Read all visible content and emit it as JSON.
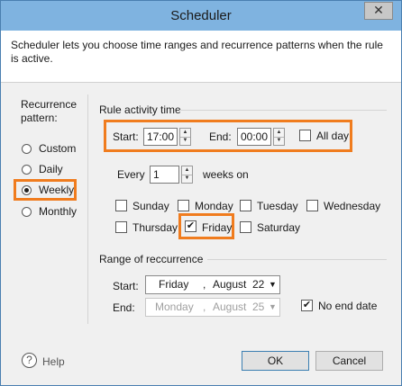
{
  "window": {
    "title": "Scheduler",
    "close_glyph": "✕"
  },
  "intro": {
    "text": "Scheduler lets you choose time ranges and recurrence patterns when the rule is active."
  },
  "recurrence": {
    "label": "Recurrence pattern:",
    "options": [
      {
        "label": "Custom",
        "selected": false
      },
      {
        "label": "Daily",
        "selected": false
      },
      {
        "label": "Weekly",
        "selected": true
      },
      {
        "label": "Monthly",
        "selected": false
      }
    ]
  },
  "activity": {
    "heading": "Rule activity time",
    "start_label": "Start:",
    "start_value": "17:00",
    "end_label": "End:",
    "end_value": "00:00",
    "all_day_label": "All day",
    "all_day_checked": false
  },
  "weekly": {
    "every_label": "Every",
    "every_value": "1",
    "weeks_on_label": "weeks on",
    "days": [
      {
        "label": "Sunday",
        "checked": false
      },
      {
        "label": "Monday",
        "checked": false
      },
      {
        "label": "Tuesday",
        "checked": false
      },
      {
        "label": "Wednesday",
        "checked": false
      },
      {
        "label": "Thursday",
        "checked": false
      },
      {
        "label": "Friday",
        "checked": true
      },
      {
        "label": "Saturday",
        "checked": false
      }
    ]
  },
  "range": {
    "heading": "Range of reccurrence",
    "start_label": "Start:",
    "start_day": "Friday",
    "start_sep": ",",
    "start_month": "August",
    "start_date": "22",
    "end_label": "End:",
    "end_day": "Monday",
    "end_sep": ",",
    "end_month": "August",
    "end_date": "25",
    "no_end_label": "No end date",
    "no_end_checked": true
  },
  "footer": {
    "help_glyph": "?",
    "help_label": "Help",
    "ok_label": "OK",
    "cancel_label": "Cancel"
  },
  "colors": {
    "titlebar": "#7fb3e0",
    "highlight": "#f07c1e"
  }
}
